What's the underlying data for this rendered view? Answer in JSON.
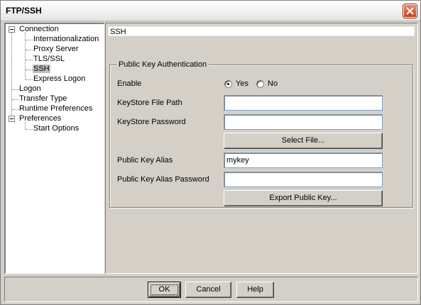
{
  "window": {
    "title": "FTP/SSH"
  },
  "tree": {
    "items": [
      {
        "label": "Connection",
        "level": 0,
        "expanded": true
      },
      {
        "label": "Internationalization",
        "level": 1
      },
      {
        "label": "Proxy Server",
        "level": 1
      },
      {
        "label": "TLS/SSL",
        "level": 1
      },
      {
        "label": "SSH",
        "level": 1,
        "selected": true
      },
      {
        "label": "Express Logon",
        "level": 1
      },
      {
        "label": "Logon",
        "level": 0
      },
      {
        "label": "Transfer Type",
        "level": 0
      },
      {
        "label": "Runtime Preferences",
        "level": 0
      },
      {
        "label": "Preferences",
        "level": 0,
        "expanded": true
      },
      {
        "label": "Start Options",
        "level": 1
      }
    ]
  },
  "main": {
    "section_title": "SSH",
    "group": {
      "legend": "Public Key Authentication",
      "enable_label": "Enable",
      "enable_yes": "Yes",
      "enable_no": "No",
      "enable_value": "Yes",
      "keystore_path_label": "KeyStore File Path",
      "keystore_path_value": "",
      "keystore_password_label": "KeyStore Password",
      "keystore_password_value": "",
      "select_file_button": "Select File...",
      "alias_label": "Public Key Alias",
      "alias_value": "mykey",
      "alias_password_label": "Public Key Alias Password",
      "alias_password_value": "",
      "export_button": "Export Public Key..."
    }
  },
  "footer": {
    "ok": "OK",
    "cancel": "Cancel",
    "help": "Help"
  },
  "colors": {
    "window_bg": "#d4d0c8",
    "close_button": "#c4411c",
    "selected_bg": "#c0c0c0"
  }
}
